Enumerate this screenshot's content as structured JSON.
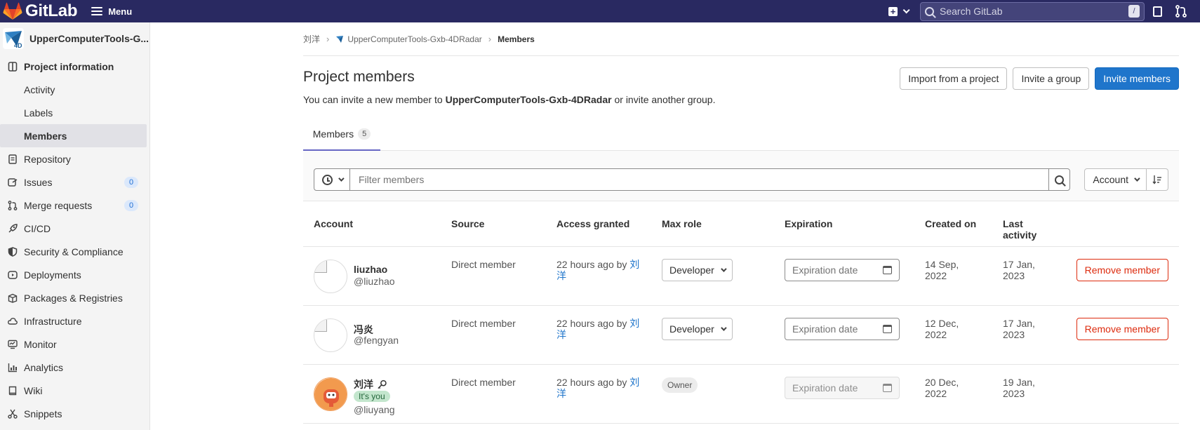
{
  "navbar": {
    "brand": "GitLab",
    "menu_label": "Menu",
    "search_placeholder": "Search GitLab",
    "search_shortcut": "/"
  },
  "sidebar": {
    "project_name": "UpperComputerTools-G...",
    "items": [
      {
        "label": "Project information",
        "icon": "info-icon"
      },
      {
        "label": "Activity"
      },
      {
        "label": "Labels"
      },
      {
        "label": "Members"
      },
      {
        "label": "Repository",
        "icon": "document-icon"
      },
      {
        "label": "Issues",
        "icon": "issues-icon",
        "count": "0"
      },
      {
        "label": "Merge requests",
        "icon": "merge-request-icon",
        "count": "0"
      },
      {
        "label": "CI/CD",
        "icon": "rocket-icon"
      },
      {
        "label": "Security & Compliance",
        "icon": "shield-icon"
      },
      {
        "label": "Deployments",
        "icon": "deployments-icon"
      },
      {
        "label": "Packages & Registries",
        "icon": "package-icon"
      },
      {
        "label": "Infrastructure",
        "icon": "cloud-icon"
      },
      {
        "label": "Monitor",
        "icon": "monitor-icon"
      },
      {
        "label": "Analytics",
        "icon": "chart-icon"
      },
      {
        "label": "Wiki",
        "icon": "book-icon"
      },
      {
        "label": "Snippets",
        "icon": "scissors-icon"
      }
    ]
  },
  "breadcrumb": {
    "owner": "刘洋",
    "project": "UpperComputerTools-Gxb-4DRadar",
    "current": "Members"
  },
  "header": {
    "title": "Project members",
    "desc_prefix": "You can invite a new member to ",
    "desc_project": "UpperComputerTools-Gxb-4DRadar",
    "desc_suffix": " or invite another group.",
    "import_button": "Import from a project",
    "invite_group_button": "Invite a group",
    "invite_members_button": "Invite members"
  },
  "tabs": [
    {
      "label": "Members",
      "count": "5"
    }
  ],
  "filter": {
    "placeholder": "Filter members",
    "sort_label": "Account"
  },
  "table": {
    "columns": [
      "Account",
      "Source",
      "Access granted",
      "Max role",
      "Expiration",
      "Created on",
      "Last activity"
    ],
    "rows": [
      {
        "name": "liuzhao",
        "handle": "@liuzhao",
        "source": "Direct member",
        "access_prefix": "22 hours ago by ",
        "access_by": "刘洋",
        "role": "Developer",
        "expiration_placeholder": "Expiration date",
        "created": "14 Sep, 2022",
        "last_activity": "17 Jan, 2023",
        "remove_label": "Remove member"
      },
      {
        "name": "冯炎",
        "handle": "@fengyan",
        "source": "Direct member",
        "access_prefix": "22 hours ago by ",
        "access_by": "刘洋",
        "role": "Developer",
        "expiration_placeholder": "Expiration date",
        "created": "12 Dec, 2022",
        "last_activity": "17 Jan, 2023",
        "remove_label": "Remove member"
      },
      {
        "name": "刘洋",
        "handle": "@liuyang",
        "you_badge": "It's you",
        "source": "Direct member",
        "access_prefix": "22 hours ago by ",
        "access_by": "刘洋",
        "role": "Owner",
        "expiration_placeholder": "Expiration date",
        "created": "20 Dec, 2022",
        "last_activity": "19 Jan, 2023"
      }
    ]
  },
  "colors": {
    "navbar": "#292961",
    "primary": "#1f75cb",
    "danger": "#dd2b0e",
    "tab_underline": "#6666c4"
  }
}
